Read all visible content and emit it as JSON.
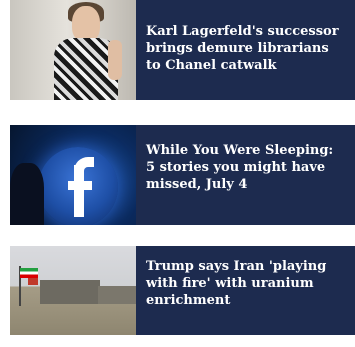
{
  "articles": [
    {
      "headline": "Karl Lagerfeld's successor brings demure librarians to Chanel catwalk",
      "thumbnail_icon": "fashion-runway-photo"
    },
    {
      "headline": "While You Were Sleeping: 5 stories you might have missed, July 4",
      "thumbnail_icon": "facebook-logo-photo"
    },
    {
      "headline": "Trump says Iran 'playing with fire' with uranium enrichment",
      "thumbnail_icon": "nuclear-facility-photo"
    }
  ],
  "colors": {
    "card_background": "#1d2b4f",
    "headline_text": "#ffffff",
    "page_background": "#ffffff"
  }
}
